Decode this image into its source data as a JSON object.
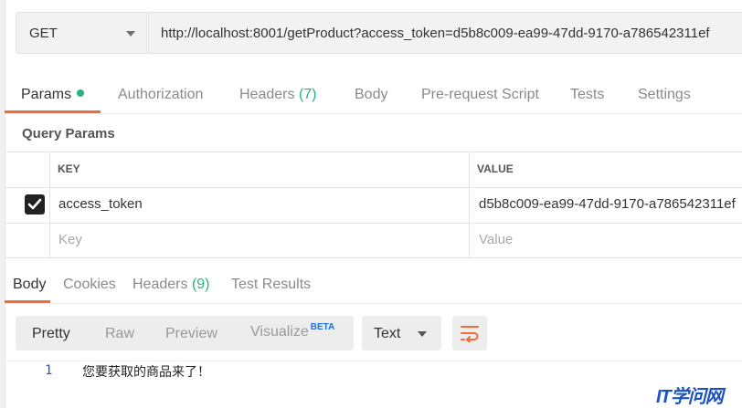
{
  "request": {
    "method": "GET",
    "url": "http://localhost:8001/getProduct?access_token=d5b8c009-ea99-47dd-9170-a786542311ef"
  },
  "request_tabs": {
    "params": "Params",
    "authorization": "Authorization",
    "headers": "Headers",
    "headers_count": "(7)",
    "body": "Body",
    "prerequest": "Pre-request Script",
    "tests": "Tests",
    "settings": "Settings"
  },
  "query_params": {
    "title": "Query Params",
    "col_key": "KEY",
    "col_value": "VALUE",
    "rows": [
      {
        "key": "access_token",
        "value": "d5b8c009-ea99-47dd-9170-a786542311ef",
        "checked": true
      }
    ],
    "key_placeholder": "Key",
    "value_placeholder": "Value"
  },
  "response_tabs": {
    "body": "Body",
    "cookies": "Cookies",
    "headers": "Headers",
    "headers_count": "(9)",
    "test_results": "Test Results"
  },
  "response_toolbar": {
    "pretty": "Pretty",
    "raw": "Raw",
    "preview": "Preview",
    "visualize": "Visualize",
    "beta": "BETA",
    "format": "Text"
  },
  "response_body": {
    "line_number": "1",
    "text": "您要获取的商品来了！"
  },
  "watermark": "IT学问网",
  "colors": {
    "accent": "#f26b3a",
    "green": "#26b47f",
    "link_blue": "#1f6fd6"
  },
  "icons": [
    "chevron-down-icon",
    "checkmark-icon",
    "wrap-lines-icon"
  ]
}
